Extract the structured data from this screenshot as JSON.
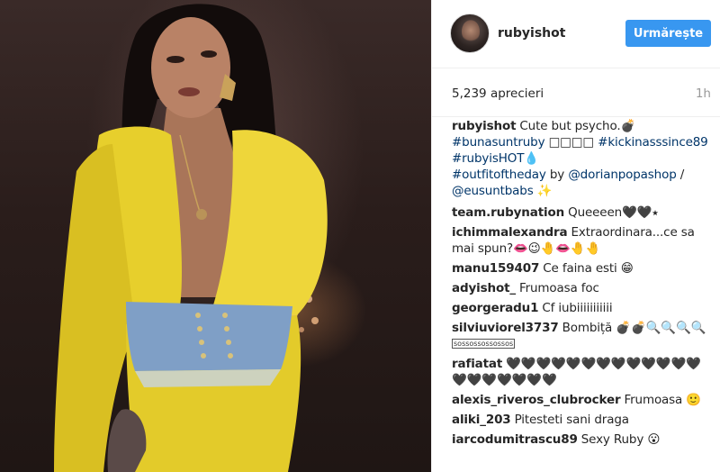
{
  "post": {
    "username": "rubyishot",
    "follow_label": "Urmărește",
    "likes": "5,239 aprecieri",
    "time": "1h",
    "caption": {
      "username": "rubyishot",
      "text": "Cute but psycho.💣",
      "line2_tag": "#bunasuntruby",
      "line2_boxes": "□□□□",
      "line2_tag2": "#kickinasssince89",
      "line3_tag": "#rubyisHOT",
      "line3_emoji": "💧",
      "line4_tag": "#outfitoftheday",
      "line4_by": "by",
      "line4_mention": "@dorianpopashop",
      "line4_slash": "/",
      "line5_mention": "@eusuntbabs",
      "line5_emoji": "✨"
    }
  },
  "comments": [
    {
      "user": "team.rubynation",
      "text": "Queeeen🖤🖤⭑"
    },
    {
      "user": "ichimmalexandra",
      "text": "Extraordinara...ce sa mai spun?👄😉🤚👄🤚🤚"
    },
    {
      "user": "manu159407",
      "text": "Ce faina esti 😁"
    },
    {
      "user": "adyishot_",
      "text": "Frumoasa foc"
    },
    {
      "user": "georgeradu1",
      "text": "Cf iubiiiiiiiiiii"
    },
    {
      "user": "silviuviorel3737",
      "text": "Bombiță 💣💣🔍🔍🔍🔍",
      "boxes": "sossossossossos"
    },
    {
      "user": "rafiatat",
      "text": "🖤🖤🖤🖤🖤🖤🖤🖤🖤🖤🖤🖤🖤🖤🖤🖤🖤🖤🖤🖤"
    },
    {
      "user": "alexis_riveros_clubrocker",
      "text": "Frumoasa 🙂"
    },
    {
      "user": "aliki_203",
      "text": "Pitesteti sani draga"
    },
    {
      "user": "iarcodumitrascu89",
      "text": "Sexy Ruby 😮"
    }
  ]
}
